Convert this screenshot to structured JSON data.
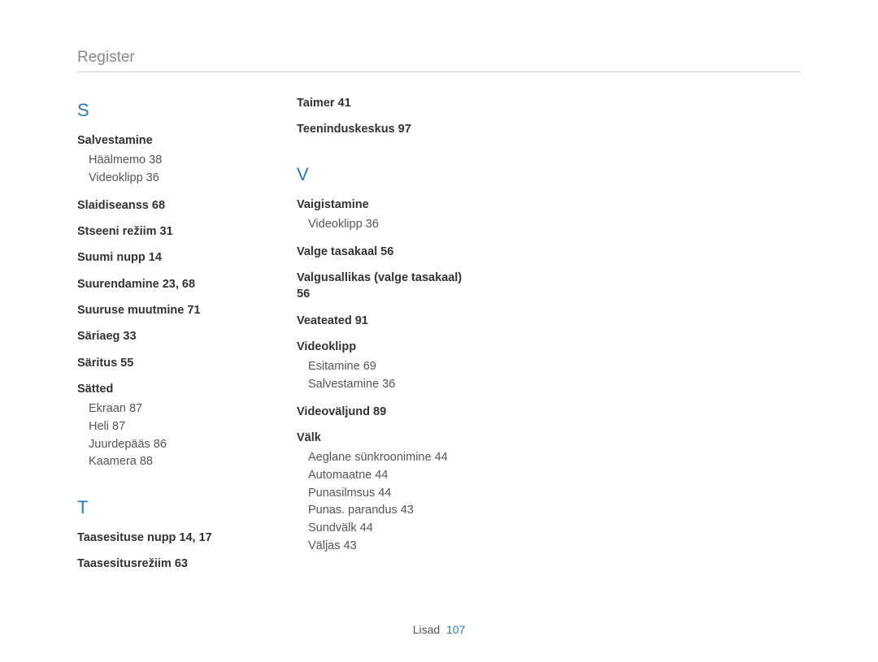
{
  "header": "Register",
  "footer": {
    "label": "Lisad",
    "page": "107"
  },
  "col1": {
    "letterS": "S",
    "salvestamine": {
      "title": "Salvestamine",
      "subs": [
        "Häälmemo  38",
        "Videoklipp  36"
      ]
    },
    "slaidiseanss": "Slaidiseanss  68",
    "stseeni": "Stseeni režiim  31",
    "suumi": "Suumi nupp  14",
    "suurendamine": "Suurendamine  23, 68",
    "suuruse": "Suuruse muutmine  71",
    "sariaeg": "Säriaeg  33",
    "saritus": "Säritus  55",
    "satted": {
      "title": "Sätted",
      "subs": [
        "Ekraan  87",
        "Heli  87",
        "Juurdepääs  86",
        "Kaamera  88"
      ]
    },
    "letterT": "T",
    "taasesituse": "Taasesituse nupp  14, 17",
    "taasesitusreziim": "Taasesitusrežiim  63"
  },
  "col2": {
    "taimer": "Taimer  41",
    "teeninduskeskus": "Teeninduskeskus  97",
    "letterV": "V",
    "vaigistamine": {
      "title": "Vaigistamine",
      "subs": [
        "Videoklipp  36"
      ]
    },
    "valge": "Valge tasakaal  56",
    "valgusallikas": "Valgusallikas (valge tasakaal)  56",
    "veateated": "Veateated  91",
    "videoklipp": {
      "title": "Videoklipp",
      "subs": [
        "Esitamine  69",
        "Salvestamine  36"
      ]
    },
    "videovaljund": "Videoväljund  89",
    "valk": {
      "title": "Välk",
      "subs": [
        "Aeglane sünkroonimine  44",
        "Automaatne  44",
        "Punasilmsus  44",
        "Punas. parandus  43",
        "Sundvälk  44",
        "Väljas  43"
      ]
    }
  }
}
